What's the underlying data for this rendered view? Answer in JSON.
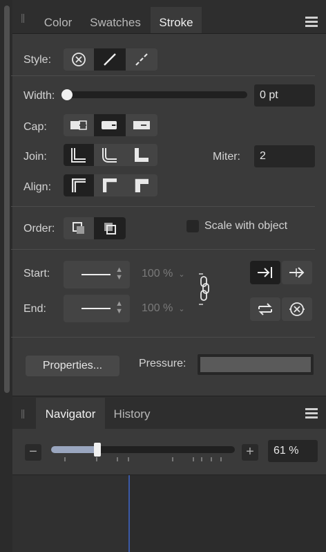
{
  "stroke_panel": {
    "tabs": [
      {
        "label": "Color",
        "active": false
      },
      {
        "label": "Swatches",
        "active": false
      },
      {
        "label": "Stroke",
        "active": true
      }
    ],
    "style_label": "Style:",
    "style_selected": "solid-line",
    "width_label": "Width:",
    "width_value": "0 pt",
    "cap_label": "Cap:",
    "join_label": "Join:",
    "miter_label": "Miter:",
    "miter_value": "2",
    "align_label": "Align:",
    "order_label": "Order:",
    "scale_with_object_label": "Scale with object",
    "scale_with_object_checked": false,
    "start_label": "Start:",
    "start_scale": "100 %",
    "end_label": "End:",
    "end_scale": "100 %",
    "properties_button": "Properties...",
    "pressure_label": "Pressure:"
  },
  "navigator_panel": {
    "tabs": [
      {
        "label": "Navigator",
        "active": true
      },
      {
        "label": "History",
        "active": false
      }
    ],
    "zoom_value": "61 %",
    "zoom_slider_fraction": 0.25
  },
  "colors": {
    "panel_bg": "#3a3a3a",
    "tabbar_bg": "#2e2e2e",
    "field_bg": "#262626",
    "accent_blue": "#3b5aa8"
  }
}
